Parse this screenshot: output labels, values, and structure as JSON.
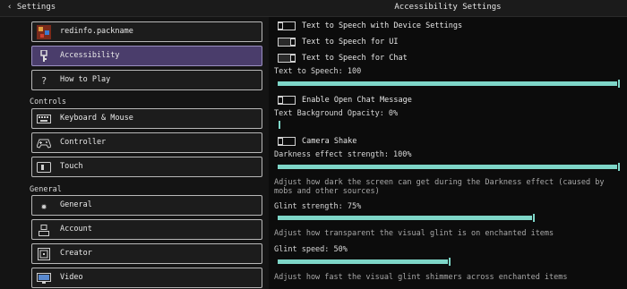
{
  "header": {
    "back_label": "‹ Settings",
    "panel_title": "Accessibility Settings"
  },
  "sidebar": {
    "items_top": [
      {
        "label": "redinfo.packname",
        "icon": "pack-icon"
      },
      {
        "label": "Accessibility",
        "icon": "accessibility-icon",
        "selected": true
      },
      {
        "label": "How to Play",
        "icon": "question-icon"
      }
    ],
    "controls_heading": "Controls",
    "controls": [
      {
        "label": "Keyboard & Mouse",
        "icon": "keyboard-icon"
      },
      {
        "label": "Controller",
        "icon": "controller-icon"
      },
      {
        "label": "Touch",
        "icon": "touch-icon"
      }
    ],
    "general_heading": "General",
    "general": [
      {
        "label": "General",
        "icon": "gear-icon"
      },
      {
        "label": "Account",
        "icon": "account-icon"
      },
      {
        "label": "Creator",
        "icon": "creator-icon"
      },
      {
        "label": "Video",
        "icon": "video-icon"
      }
    ]
  },
  "settings": {
    "tts_device": {
      "label": "Text to Speech with Device Settings",
      "value": "off"
    },
    "tts_ui": {
      "label": "Text to Speech for UI",
      "value": "on"
    },
    "tts_chat": {
      "label": "Text to Speech for Chat",
      "value": "on"
    },
    "tts_volume": {
      "label": "Text to Speech: 100",
      "value": 100
    },
    "open_chat": {
      "label": "Enable Open Chat Message",
      "value": "off"
    },
    "text_bg": {
      "label": "Text Background Opacity: 0%",
      "value": 0
    },
    "camera_shake": {
      "label": "Camera Shake",
      "value": "off"
    },
    "darkness": {
      "label": "Darkness effect strength: 100%",
      "value": 100,
      "desc": "Adjust how dark the screen can get during the Darkness effect (caused by mobs and other sources)"
    },
    "glint_strength": {
      "label": "Glint strength: 75%",
      "value": 75,
      "desc": "Adjust how transparent the visual glint is on enchanted items"
    },
    "glint_speed": {
      "label": "Glint speed: 50%",
      "value": 50,
      "desc": "Adjust how fast the visual glint shimmers across enchanted items"
    }
  },
  "colors": {
    "accent": "#7ed6c8",
    "selected_bg": "#4a3d6b"
  }
}
